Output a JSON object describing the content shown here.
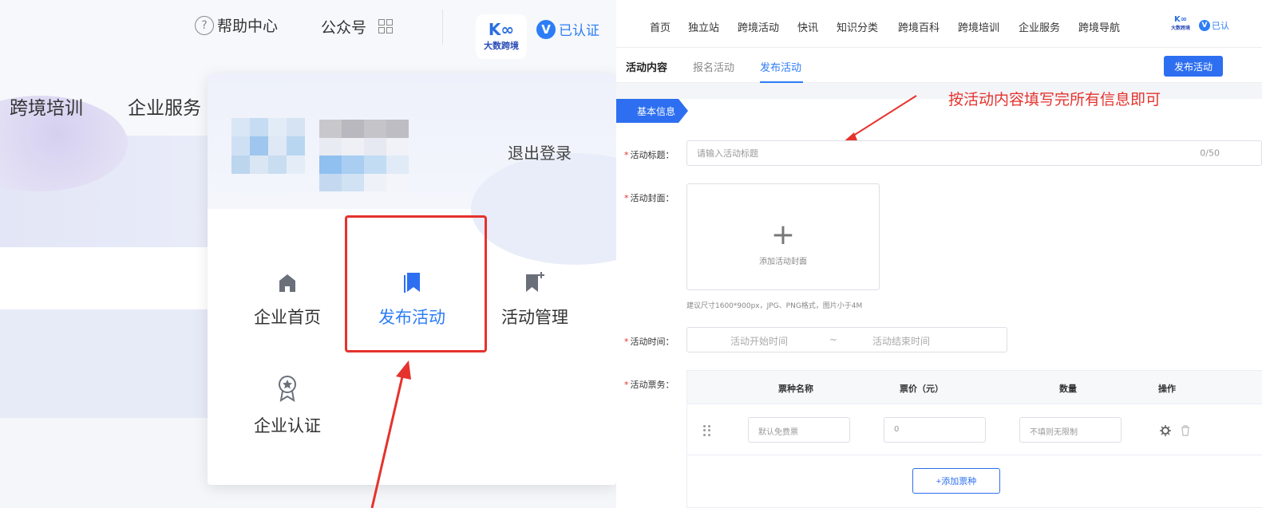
{
  "left": {
    "header": {
      "help_center": "帮助中心",
      "help_icon_glyph": "?",
      "official_account": "公众号",
      "logo_mark": "K∞",
      "logo_name": "大数跨境",
      "verified_badge": "V",
      "verified_label": "已认证"
    },
    "nav": [
      "跨境培训",
      "企业服务"
    ],
    "dropdown": {
      "logout": "退出登录",
      "items": [
        {
          "label": "企业首页",
          "icon": "home-icon"
        },
        {
          "label": "发布活动",
          "icon": "bookmark-icon",
          "active": true
        },
        {
          "label": "活动管理",
          "icon": "bookmark-plus-icon"
        },
        {
          "label": "企业认证",
          "icon": "award-icon"
        }
      ]
    },
    "colors": {
      "accent": "#2d7df6",
      "highlight": "#e6322d"
    }
  },
  "right": {
    "topnav": [
      "首页",
      "独立站",
      "跨境活动",
      "快讯",
      "知识分类",
      "跨境百科",
      "跨境培训",
      "企业服务",
      "跨境导航"
    ],
    "logo_mark": "K∞",
    "logo_name": "大数跨境",
    "verified_badge": "V",
    "verified_label": "已认",
    "tabs": [
      "活动内容",
      "报名活动",
      "发布活动"
    ],
    "publish_button": "发布活动",
    "section_label": "基本信息",
    "annotation": "按活动内容填写完所有信息即可",
    "form": {
      "required_mark": "*",
      "title_label": "活动标题：",
      "title_placeholder": "请输入活动标题",
      "title_count": "0/50",
      "cover_label": "活动封面：",
      "cover_plus": "+",
      "cover_upload": "添加活动封面",
      "cover_hint": "建议尺寸1600*900px，JPG、PNG格式，图片小于4M",
      "time_label": "活动时间：",
      "time_start": "活动开始时间",
      "time_sep": "~",
      "time_end": "活动结束时间",
      "ticket_label": "活动票务：",
      "ticket_headers": [
        "票种名称",
        "票价（元）",
        "数量",
        "操作"
      ],
      "ticket_row": {
        "name": "默认免费票",
        "price": "0",
        "quantity": "不填则无限制"
      },
      "add_ticket": "+添加票种"
    }
  }
}
